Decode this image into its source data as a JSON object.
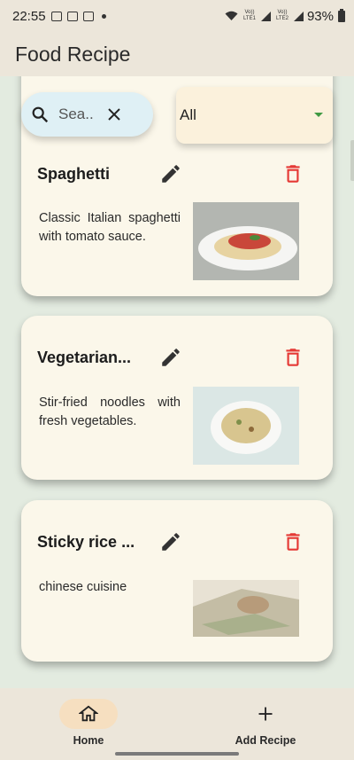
{
  "status_bar": {
    "time": "22:55",
    "network1": "Vo)) LTE1",
    "network2": "Vo)) LTE2",
    "battery": "93%"
  },
  "app_bar": {
    "title": "Food Recipe"
  },
  "search": {
    "value": "Sea..."
  },
  "filter": {
    "selected": "All"
  },
  "recipes": [
    {
      "title": "Spaghetti",
      "description": "Classic Italian spaghetti with tomato sauce."
    },
    {
      "title": "Vegetarian...",
      "description": "Stir-fried noodles with fresh vegetables."
    },
    {
      "title": "Sticky rice ...",
      "description": "chinese cuisine"
    }
  ],
  "bottom_nav": {
    "home_label": "Home",
    "add_label": "Add Recipe"
  },
  "colors": {
    "background": "#e3ebe0",
    "card": "#fbf7ea",
    "delete": "#e53935",
    "accent_green": "#3f9a43"
  }
}
